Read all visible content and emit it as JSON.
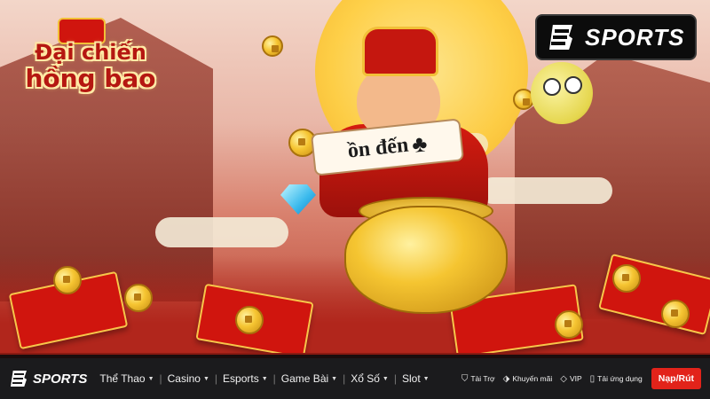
{
  "banner": {
    "game_title_line1": "Đại chiến",
    "game_title_line2": "hồng bao",
    "scroll_text": "ồn đến",
    "scroll_icon": "club-suit-icon",
    "logo_text": "SPORTS",
    "logo_mark": "B"
  },
  "nav": {
    "logo_text": "SPORTS",
    "menu": [
      {
        "label": "Thể Thao"
      },
      {
        "label": "Casino"
      },
      {
        "label": "Esports"
      },
      {
        "label": "Game Bài"
      },
      {
        "label": "Xổ Số"
      },
      {
        "label": "Slot"
      }
    ],
    "links": [
      {
        "label": "Tài Trợ",
        "icon": "shield-icon"
      },
      {
        "label": "Khuyến mãi",
        "icon": "tag-icon"
      },
      {
        "label": "VIP",
        "icon": "diamond-icon"
      },
      {
        "label": "Tải ứng dụng",
        "icon": "phone-icon"
      }
    ],
    "cta_label": "Nạp/Rút"
  },
  "colors": {
    "nav_bg": "#1b1b1d",
    "cta": "#e2231a",
    "accent_gold": "#f5c531",
    "accent_red": "#c5170f"
  }
}
